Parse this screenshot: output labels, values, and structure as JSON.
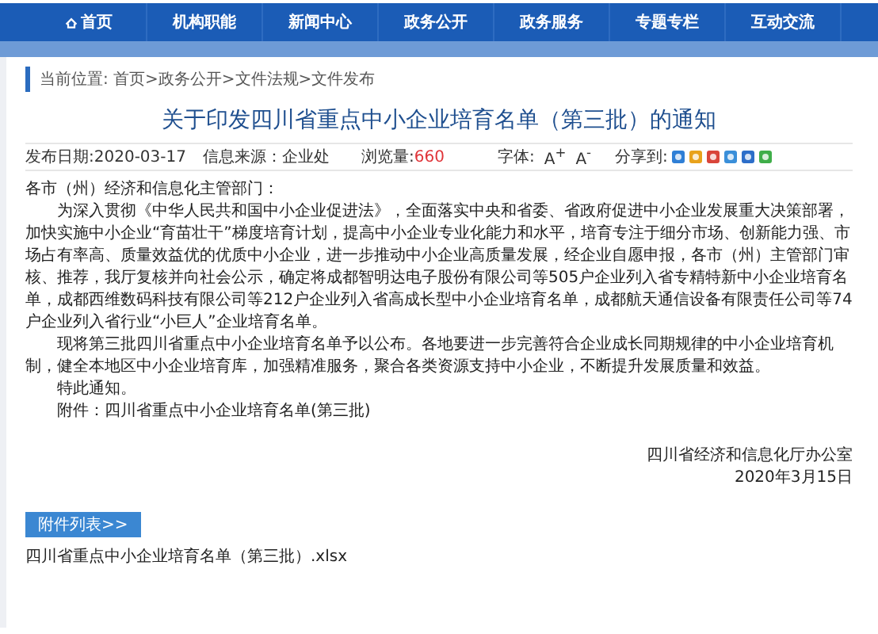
{
  "nav": [
    {
      "label": "首页",
      "kind": "home"
    },
    {
      "label": "机构职能",
      "kind": "link"
    },
    {
      "label": "新闻中心",
      "kind": "link"
    },
    {
      "label": "政务公开",
      "kind": "link"
    },
    {
      "label": "政务服务",
      "kind": "link"
    },
    {
      "label": "专题专栏",
      "kind": "link"
    },
    {
      "label": "互动交流",
      "kind": "link"
    }
  ],
  "breadcrumb": "当前位置: 首页>政务公开>文件法规>文件发布",
  "article": {
    "title": "关于印发四川省重点中小企业培育名单（第三批）的通知",
    "meta": {
      "date": "发布日期:2020-03-17",
      "source_label": "信息来源：",
      "source": "企业处",
      "views_label": "浏览量:",
      "views": "660",
      "font_label": "字体:",
      "font_up": "A$^{+}$",
      "font_down": "A$^{-}$",
      "share_label": "分享到:"
    },
    "greeting": "各市（州）经济和信息化主管部门：",
    "paragraphs": [
      "为深入贯彻《中华人民共和国中小企业促进法》，全面落实中央和省委、省政府促进中小企业发展重大决策部署，加快实施中小企业“育苗壮干”梯度培育计划，提高中小企业专业化能力和水平，培育专注于细分市场、创新能力强、市场占有率高、质量效益优的优质中小企业，进一步推动中小企业高质量发展，经企业自愿申报，各市（州）主管部门审核、推荐，我厅复核并向社会公示，确定将成都智明达电子股份有限公司等505户企业列入省专精特新中小企业培育名单，成都西维数码科技有限公司等212户企业列入省高成长型中小企业培育名单，成都航天通信设备有限责任公司等74户企业列入省行业“小巨人”企业培育名单。",
      "现将第三批四川省重点中小企业培育名单予以公布。各地要进一步完善符合企业成长同期规律的中小企业培育机制，健全本地区中小企业培育库，加强精准服务，聚合各类资源支持中小企业，不断提升发展质量和效益。",
      "特此通知。"
    ],
    "attachment_label": "附件：",
    "attachment_name": "四川省重点中小企业培育名单(第三批)",
    "signature": "四川省经济和信息化厅办公室",
    "signature_date": "2020年3月15日"
  },
  "attachments": {
    "heading": "附件列表>>",
    "files": [
      "四川省重点中小企业培育名单（第三批）.xlsx"
    ]
  }
}
